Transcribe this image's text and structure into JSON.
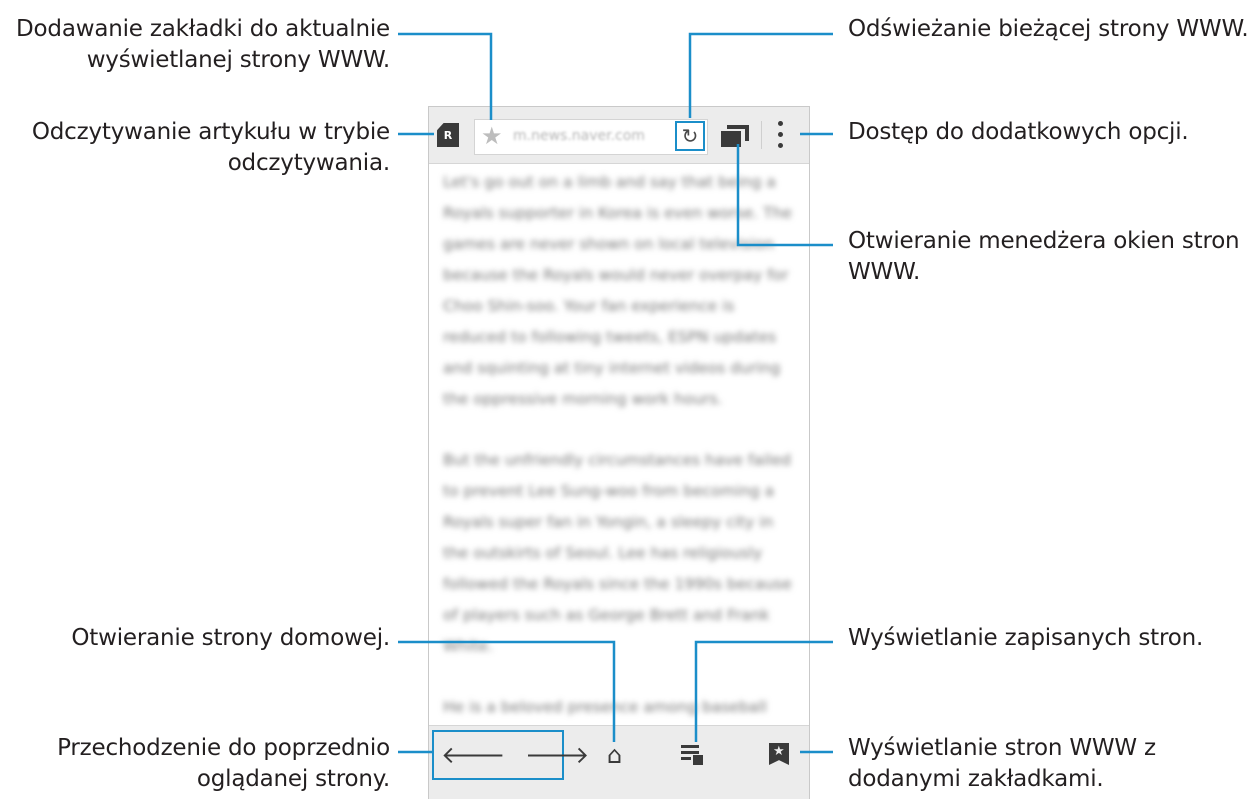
{
  "annotations": {
    "bookmark_add": [
      "Dodawanie zakładki do aktualnie",
      "wyświetlanej strony WWW."
    ],
    "reader_mode": [
      "Odczytywanie artykułu w trybie",
      "odczytywania."
    ],
    "refresh": [
      "Odświeżanie bieżącej strony WWW."
    ],
    "more_options": [
      "Dostęp do dodatkowych opcji."
    ],
    "window_manager": [
      "Otwieranie menedżera okien stron",
      "WWW."
    ],
    "home": [
      "Otwieranie strony domowej."
    ],
    "saved_pages": [
      "Wyświetlanie zapisanych stron."
    ],
    "back": [
      "Przechodzenie do poprzednio",
      "oglądanej strony."
    ],
    "bookmarks": [
      "Wyświetlanie stron WWW z",
      "dodanymi zakładkami."
    ]
  },
  "browser": {
    "url": "m.news.naver.com",
    "reader_label": "R",
    "article": [
      "Let's go out on a limb and say that being a Royals supporter in Korea is even worse. The games are never shown on local television because the Royals would never overpay for Choo Shin-soo. Your fan experience is reduced to following tweets, ESPN updates and squinting at tiny internet videos during the oppressive morning work hours.",
      "But the unfriendly circumstances have failed to prevent Lee Sung-woo from becoming a Royals super fan in Yongin, a sleepy city in the outskirts of Seoul. Lee has religiously followed the Royals since the 1990s because of players such as George Brett and Frank White.",
      "He is a beloved presence among baseball fans on Twitter for his positive attitude and optimism, which are not always what you"
    ]
  },
  "icons": {
    "star": "star-icon",
    "refresh": "refresh-icon",
    "back": "arrow-left-icon",
    "forward": "arrow-right-icon",
    "home": "home-icon",
    "saved": "saved-pages-icon",
    "bookmarks": "bookmark-icon"
  },
  "colors": {
    "leader": "#1b8ec9",
    "toolbar": "#ececec",
    "icon": "#3a3a3a"
  }
}
